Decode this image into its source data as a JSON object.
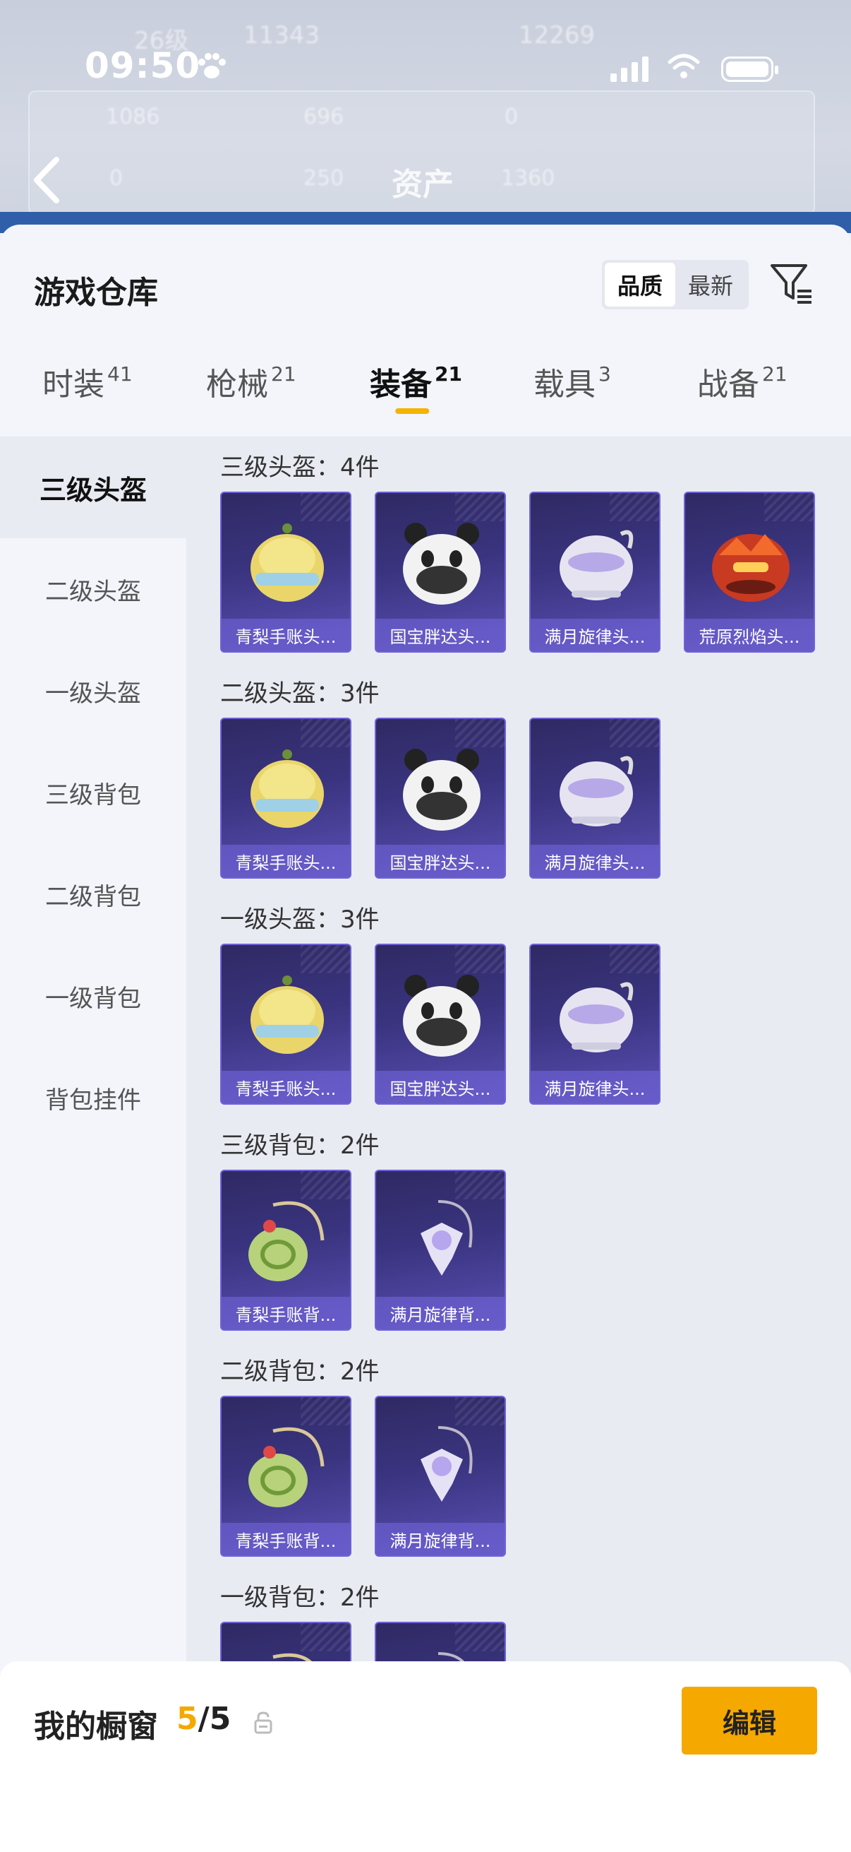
{
  "status_bar": {
    "time": "09:50"
  },
  "background": {
    "title": "资产",
    "ghost_texts": [
      "26级",
      "11343",
      "12269",
      "1086",
      "696",
      "0",
      "0",
      "250",
      "1360"
    ]
  },
  "sheet": {
    "title": "游戏仓库",
    "sort": {
      "options": [
        "品质",
        "最新"
      ],
      "active": "品质"
    }
  },
  "tabs": [
    {
      "label": "时装",
      "count": "41"
    },
    {
      "label": "枪械",
      "count": "21"
    },
    {
      "label": "装备",
      "count": "21",
      "active": true
    },
    {
      "label": "载具",
      "count": "3"
    },
    {
      "label": "战备",
      "count": "21"
    }
  ],
  "sidebar": {
    "items": [
      "三级头盔",
      "二级头盔",
      "一级头盔",
      "三级背包",
      "二级背包",
      "一级背包",
      "背包挂件"
    ],
    "active": "三级头盔"
  },
  "sections": [
    {
      "label": "三级头盔：4件",
      "items": [
        {
          "name": "青梨手账头...",
          "icon": "pear-helmet-icon"
        },
        {
          "name": "国宝胖达头...",
          "icon": "panda-helmet-icon"
        },
        {
          "name": "满月旋律头...",
          "icon": "moon-helmet-icon"
        },
        {
          "name": "荒原烈焰头...",
          "icon": "flame-helmet-icon"
        }
      ]
    },
    {
      "label": "二级头盔：3件",
      "items": [
        {
          "name": "青梨手账头...",
          "icon": "pear-helmet-icon"
        },
        {
          "name": "国宝胖达头...",
          "icon": "panda-helmet-icon"
        },
        {
          "name": "满月旋律头...",
          "icon": "moon-helmet-icon"
        }
      ]
    },
    {
      "label": "一级头盔：3件",
      "items": [
        {
          "name": "青梨手账头...",
          "icon": "pear-helmet-icon"
        },
        {
          "name": "国宝胖达头...",
          "icon": "panda-helmet-icon"
        },
        {
          "name": "满月旋律头...",
          "icon": "moon-helmet-icon"
        }
      ]
    },
    {
      "label": "三级背包：2件",
      "items": [
        {
          "name": "青梨手账背...",
          "icon": "pear-backpack-icon"
        },
        {
          "name": "满月旋律背...",
          "icon": "moon-backpack-icon"
        }
      ]
    },
    {
      "label": "二级背包：2件",
      "items": [
        {
          "name": "青梨手账背...",
          "icon": "pear-backpack-icon"
        },
        {
          "name": "满月旋律背...",
          "icon": "moon-backpack-icon"
        }
      ]
    },
    {
      "label": "一级背包：2件",
      "items": [
        {
          "name": "",
          "icon": "pear-backpack-icon"
        },
        {
          "name": "",
          "icon": "moon-backpack-icon"
        }
      ]
    }
  ],
  "showcase": {
    "label": "我的橱窗",
    "current": "5",
    "total": "/5",
    "edit_label": "编辑"
  },
  "colors": {
    "accent": "#f5a800",
    "card_bg": "#3a3480",
    "sheet_bg": "#f3f5fb"
  }
}
